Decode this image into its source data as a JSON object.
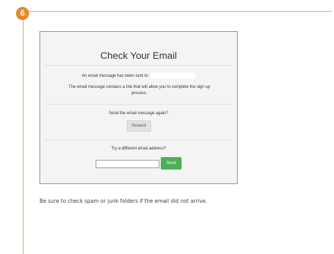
{
  "step": {
    "number": "6",
    "accent_color": "#e68a2e"
  },
  "dialog": {
    "title": "Check Your Email",
    "sent_label": "An email message has been sent to:",
    "description": "The email message contains a link that will allow you to complete the sign up process.",
    "resend_question": "Send the email message again?",
    "resend_button": "Resend",
    "different_email_question": "Try a different email address?",
    "email_input_value": "",
    "send_button": "Send",
    "send_button_color": "#4fae5a"
  },
  "note": {
    "text": "Be sure to check spam or junk folders if the email did not arrive."
  }
}
